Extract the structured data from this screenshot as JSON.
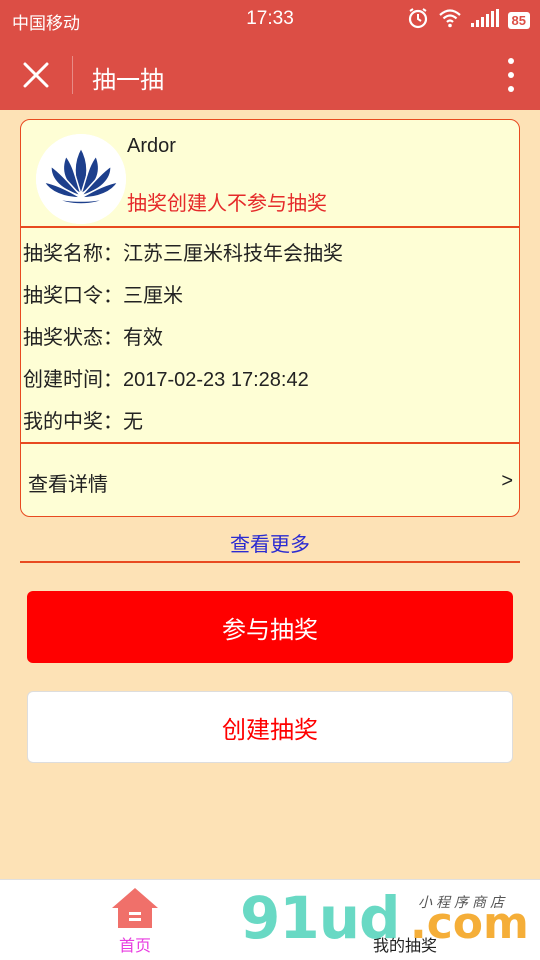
{
  "status_bar": {
    "carrier": "中国移动",
    "time": "17:33",
    "battery": "85",
    "icons": [
      "alarm-icon",
      "wifi-icon",
      "signal-icon",
      "battery-icon"
    ]
  },
  "navbar": {
    "title": "抽一抽",
    "close_icon": "close-icon",
    "more_icon": "more-vertical-icon"
  },
  "lottery_card": {
    "username": "Ardor",
    "creator_note": "抽奖创建人不参与抽奖",
    "rows": [
      {
        "label": "抽奖名称：",
        "value": "江苏三厘米科技年会抽奖"
      },
      {
        "label": "抽奖口令：",
        "value": "三厘米"
      },
      {
        "label": "抽奖状态：",
        "value": "有效"
      },
      {
        "label": "创建时间：",
        "value": "2017-02-23 17:28:42"
      },
      {
        "label": "我的中奖：",
        "value": "无"
      }
    ],
    "detail_label": "查看详情",
    "detail_arrow": ">"
  },
  "more_link": "查看更多",
  "buttons": {
    "join": "参与抽奖",
    "create": "创建抽奖"
  },
  "tabbar": {
    "home": "首页",
    "mine": "我的抽奖"
  },
  "watermark": {
    "text": "91ud",
    "suffix": ".com",
    "sub": "小程序商店"
  },
  "colors": {
    "header": "#dc4e45",
    "background": "#fde2b6",
    "card_bg": "#fefed5",
    "card_border": "#e84a20",
    "accent_red": "#ff0000",
    "link_blue": "#2b2bd1",
    "tab_active": "#e83de0"
  }
}
